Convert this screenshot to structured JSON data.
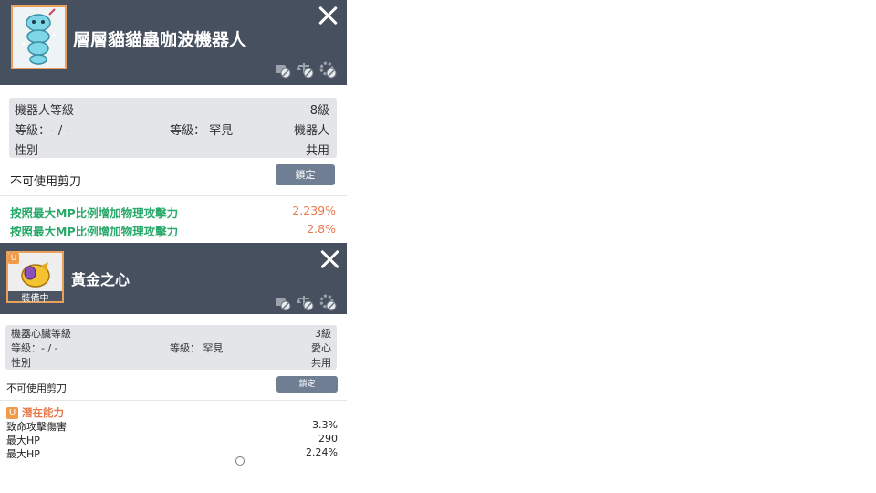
{
  "panel1": {
    "title": "層層貓貓蟲咖波機器人",
    "icons": [
      "transfer-lock-icon",
      "scale-lock-icon",
      "gear-lock-icon"
    ],
    "stats": {
      "row1": {
        "label": "機器人等級",
        "value": "8級"
      },
      "row2": {
        "left": "等級：- / -",
        "mid": "等級： 罕見",
        "right": "機器人"
      },
      "row3": {
        "label": "性別",
        "value": "共用"
      }
    },
    "scissors_text": "不可使用剪刀",
    "lock_label": "鎖定",
    "options": [
      {
        "label": "按照最大MP比例增加物理攻擊力",
        "value": "2.239%"
      },
      {
        "label": "按照最大MP比例增加物理攻擊力",
        "value": "2.8%"
      }
    ]
  },
  "panel2": {
    "title": "黃金之心",
    "badge": "U",
    "equipped_label": "裝備中",
    "icons": [
      "transfer-lock-icon",
      "scale-lock-icon",
      "gear-lock-icon"
    ],
    "stats": {
      "row1": {
        "label": "機器心臟等級",
        "value": "3級"
      },
      "row2": {
        "left": "等級：- / -",
        "mid": "等級： 罕見",
        "right": "愛心"
      },
      "row3": {
        "label": "性別",
        "value": "共用"
      }
    },
    "scissors_text": "不可使用剪刀",
    "lock_label": "鎖定",
    "potential": {
      "badge": "U",
      "title": "潛在能力",
      "lines": [
        {
          "label": "致命攻擊傷害",
          "value": "3.3%"
        },
        {
          "label": "最大HP",
          "value": "290"
        },
        {
          "label": "最大HP",
          "value": "2.24%"
        }
      ]
    }
  },
  "colors": {
    "header": "#46505f",
    "accent": "#e8a05a",
    "green": "#29a96a",
    "orange": "#e8794d",
    "button": "#6f7e93"
  }
}
